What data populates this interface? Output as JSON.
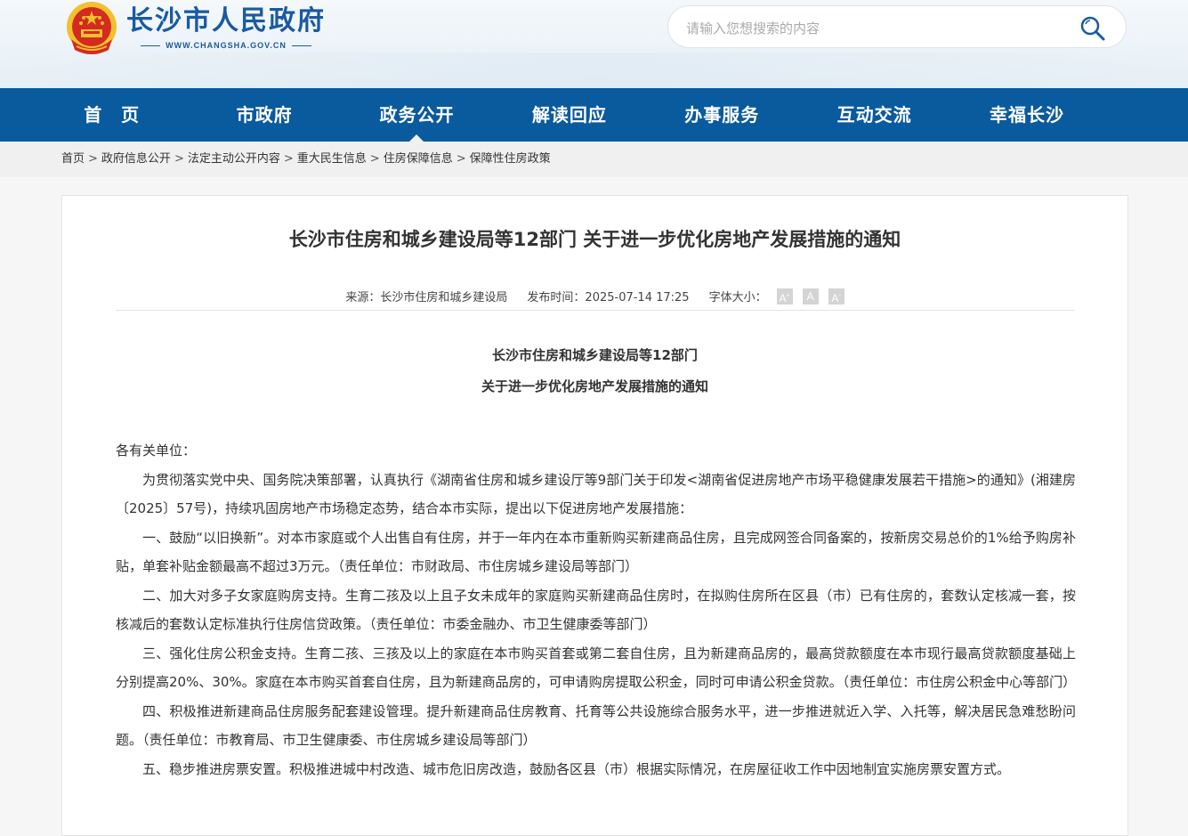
{
  "header": {
    "site_title": "长沙市人民政府",
    "site_url": "WWW.CHANGSHA.GOV.CN",
    "search_placeholder": "请输入您想搜索的内容"
  },
  "nav": {
    "items": [
      "首　页",
      "市政府",
      "政务公开",
      "解读回应",
      "办事服务",
      "互动交流",
      "幸福长沙"
    ],
    "active_index": 2
  },
  "breadcrumb": [
    "首页",
    "政府信息公开",
    "法定主动公开内容",
    "重大民生信息",
    "住房保障信息",
    "保障性住房政策"
  ],
  "article": {
    "title": "长沙市住房和城乡建设局等12部门 关于进一步优化房地产发展措施的通知",
    "source_label": "来源：长沙市住房和城乡建设局",
    "date_label": "发布时间：2025-07-14 17:25",
    "fontsize_label": "字体大小：",
    "fontsize_buttons": [
      "A",
      "A",
      "A"
    ],
    "doc_heading_1": "长沙市住房和城乡建设局等12部门",
    "doc_heading_2": "关于进一步优化房地产发展措施的通知",
    "salutation": "各有关单位：",
    "paragraphs": [
      "为贯彻落实党中央、国务院决策部署，认真执行《湖南省住房和城乡建设厅等9部门关于印发<湖南省促进房地产市场平稳健康发展若干措施>的通知》(湘建房〔2025〕57号)，持续巩固房地产市场稳定态势，结合本市实际，提出以下促进房地产发展措施：",
      "一、鼓励“以旧换新”。对本市家庭或个人出售自有住房，并于一年内在本市重新购买新建商品住房，且完成网签合同备案的，按新房交易总价的1%给予购房补贴，单套补贴金额最高不超过3万元。（责任单位：市财政局、市住房城乡建设局等部门）",
      "二、加大对多子女家庭购房支持。生育二孩及以上且子女未成年的家庭购买新建商品住房时，在拟购住房所在区县（市）已有住房的，套数认定核减一套，按核减后的套数认定标准执行住房信贷政策。（责任单位：市委金融办、市卫生健康委等部门）",
      "三、强化住房公积金支持。生育二孩、三孩及以上的家庭在本市购买首套或第二套自住房，且为新建商品房的，最高贷款额度在本市现行最高贷款额度基础上分别提高20%、30%。家庭在本市购买首套自住房，且为新建商品房的，可申请购房提取公积金，同时可申请公积金贷款。（责任单位：市住房公积金中心等部门）",
      "四、积极推进新建商品住房服务配套建设管理。提升新建商品住房教育、托育等公共设施综合服务水平，进一步推进就近入学、入托等，解决居民急难愁盼问题。（责任单位：市教育局、市卫生健康委、市住房城乡建设局等部门）",
      "五、稳步推进房票安置。积极推进城中村改造、城市危旧房改造，鼓励各区县（市）根据实际情况，在房屋征收工作中因地制宜实施房票安置方式。"
    ]
  },
  "colors": {
    "nav_bg": "#0a5a9e",
    "brand_blue": "#1a5aa0",
    "emblem_red": "#d42a1f",
    "emblem_gold": "#f2c12e"
  },
  "icons": [
    "national-emblem-icon",
    "search-icon"
  ]
}
